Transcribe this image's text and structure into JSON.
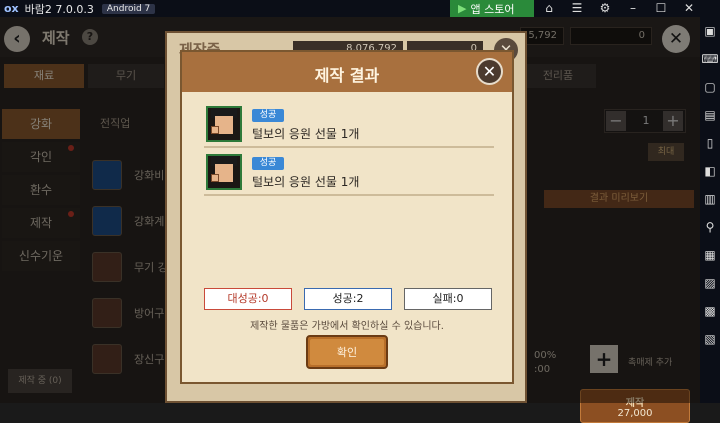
{
  "emulator": {
    "logo": "ox",
    "title": "바람2 7.0.0.3",
    "android": "Android 7",
    "store": "앱 스토어",
    "controls": [
      "⌂",
      "☰",
      "⚙",
      "–",
      "☐",
      "✕"
    ],
    "side_icons": [
      "▣",
      "⌨",
      "▢",
      "▤",
      "▯",
      "◧",
      "▥",
      "⚲",
      "▦",
      "▨",
      "▩",
      "▧"
    ]
  },
  "game": {
    "title": "제작",
    "resources": {
      "gold": "5,792",
      "red": "0"
    },
    "tabs": [
      "재료",
      "무기",
      "전리품"
    ],
    "side_menu": [
      {
        "label": "강화",
        "active": true,
        "dot": false
      },
      {
        "label": "각인",
        "active": false,
        "dot": true
      },
      {
        "label": "환수",
        "active": false,
        "dot": false
      },
      {
        "label": "제작",
        "active": false,
        "dot": true
      },
      {
        "label": "신수기운",
        "active": false,
        "dot": false
      }
    ],
    "list_header": "전직업",
    "list_items": [
      "강화비",
      "강화계",
      "무기 강",
      "방어구",
      "장신구"
    ],
    "making_button": "제작 중 (0)",
    "right_panel": {
      "qty": "1",
      "max": "최대",
      "preview": "결과 미리보기",
      "pct_lines": [
        "00%",
        ":00"
      ],
      "add_catalyst": "촉매제 추가",
      "craft_label": "제작",
      "craft_cost": "27,000"
    }
  },
  "background_modal": {
    "title": "제작중",
    "gold": "8,076,792",
    "red": "0"
  },
  "modal": {
    "title": "제작 결과",
    "results": [
      {
        "badge": "성공",
        "text": "털보의 응원 선물 1개"
      },
      {
        "badge": "성공",
        "text": "털보의 응원 선물 1개"
      }
    ],
    "stats": {
      "great": "대성공:0",
      "success": "성공:2",
      "fail": "실패:0"
    },
    "notice": "제작한 물품은 가방에서 확인하실 수 있습니다.",
    "confirm": "확인"
  }
}
